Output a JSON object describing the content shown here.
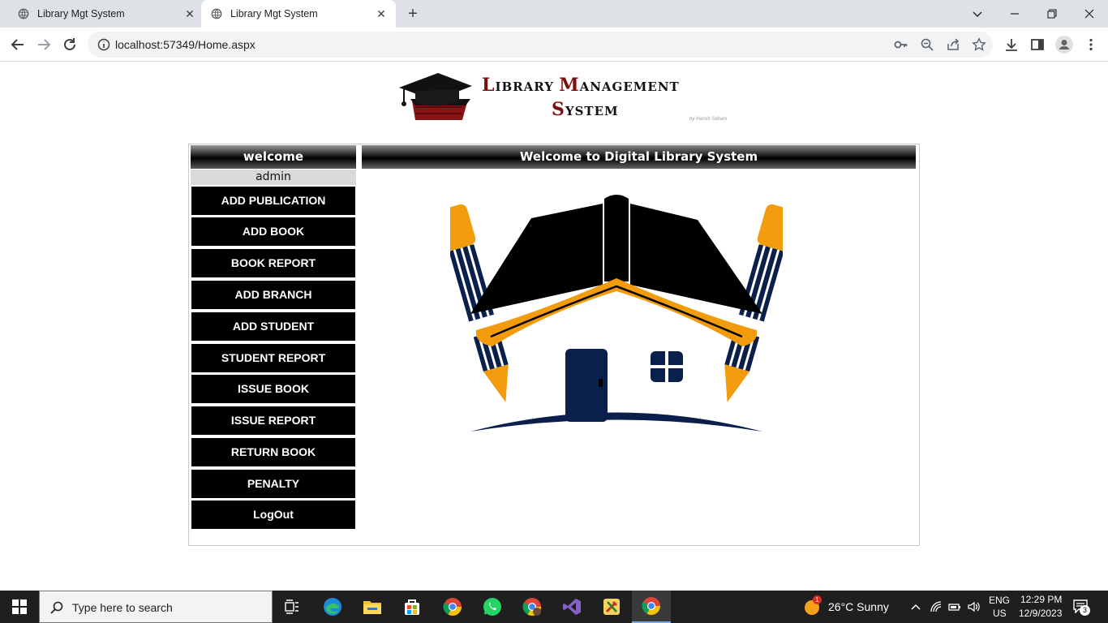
{
  "browser": {
    "tabs": [
      {
        "title": "Library Mgt System"
      },
      {
        "title": "Library Mgt System"
      }
    ],
    "url": "localhost:57349/Home.aspx"
  },
  "logo": {
    "line1_big1": "L",
    "line1_rest1": "IBRARY ",
    "line1_big2": "M",
    "line1_rest2": "ANAGEMENT",
    "line2_big": "S",
    "line2_rest": "YSTEM",
    "byline": "by-Harish Sahani"
  },
  "sidebar": {
    "header": "welcome",
    "user": "admin",
    "items": [
      {
        "label": "ADD PUBLICATION"
      },
      {
        "label": "ADD BOOK"
      },
      {
        "label": "BOOK REPORT"
      },
      {
        "label": "ADD BRANCH"
      },
      {
        "label": "ADD STUDENT"
      },
      {
        "label": "STUDENT REPORT"
      },
      {
        "label": "ISSUE BOOK"
      },
      {
        "label": "ISSUE REPORT"
      },
      {
        "label": "RETURN BOOK"
      },
      {
        "label": "PENALTY"
      },
      {
        "label": "LogOut"
      }
    ]
  },
  "main": {
    "header": "Welcome to Digital Library System"
  },
  "taskbar": {
    "search_placeholder": "Type here to search",
    "weather": "26°C  Sunny",
    "weather_badge": "1",
    "lang1": "ENG",
    "lang2": "US",
    "time": "12:29 PM",
    "date": "12/9/2023",
    "notif_count": "3"
  },
  "colors": {
    "accent_dark_red": "#7a0f10",
    "menu_bg": "#000000",
    "pencil_orange": "#f29b0c",
    "navy": "#0b1f4d"
  }
}
